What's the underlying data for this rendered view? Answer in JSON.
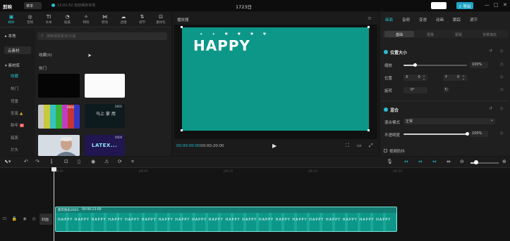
{
  "app": {
    "logo": "剪映",
    "menu_label": "菜单",
    "autosave_text": "13:01:52 自动保存本地",
    "project_title": "1723日",
    "export_label": "导出",
    "window_controls": [
      "—",
      "□",
      "✕"
    ]
  },
  "media_tabs": [
    {
      "icon": "▣",
      "label": "媒体",
      "icon_name": "media-icon",
      "active": true
    },
    {
      "icon": "◎",
      "label": "音频",
      "icon_name": "audio-icon"
    },
    {
      "icon": "TI",
      "label": "文本",
      "icon_name": "text-icon"
    },
    {
      "icon": "◔",
      "label": "贴纸",
      "icon_name": "sticker-icon"
    },
    {
      "icon": "✧",
      "label": "特效",
      "icon_name": "effects-icon"
    },
    {
      "icon": "⋈",
      "label": "转场",
      "icon_name": "transition-icon"
    },
    {
      "icon": "☁",
      "label": "滤镜",
      "icon_name": "filter-icon"
    },
    {
      "icon": "⇅",
      "label": "调节",
      "icon_name": "adjust-icon"
    },
    {
      "icon": "⊡",
      "label": "素材包",
      "icon_name": "package-icon"
    }
  ],
  "sidebar": {
    "local": "▸ 本地",
    "cloud": "云素材",
    "library": "▾ 素材库",
    "items": [
      "收藏",
      "热门",
      "背景",
      "圣诞",
      "新年",
      "搞笑",
      "片头"
    ],
    "christmas_badge": "▲",
    "new_year_badge": "新"
  },
  "search": {
    "placeholder": "搜索视频素材/元素"
  },
  "library": {
    "section_favorites": "收藏(0)",
    "section_hot": "热门",
    "thumb_bars_time": "0002",
    "thumb_dark_text": "马上 掌 用",
    "thumb_dark_time": "0001",
    "thumb_latex_text": "LATEX...",
    "thumb_latex_time": "0000"
  },
  "player": {
    "title": "播放器",
    "menu_icon": "≡",
    "canvas_text": "HAPPY",
    "canvas_hearts": "✦ ✦ ♥ ♥ ♥ ♥",
    "current_time": "00:00:00:00",
    "total_time": "00:00:20:00",
    "play_icon": "▶",
    "controls": [
      "⛶",
      "▭",
      "⤢"
    ]
  },
  "right_panel": {
    "tabs": [
      "画面",
      "音频",
      "变速",
      "动画",
      "跟踪",
      "调节"
    ],
    "subtabs": [
      "基础",
      "抠像",
      "蒙版",
      "背景填充"
    ],
    "position_size": {
      "title": "位置大小",
      "scale_label": "缩放",
      "scale_value": "100%",
      "scale_level": 0.18,
      "position_label": "位置",
      "x_label": "X",
      "x_value": "0",
      "y_label": "Y",
      "y_value": "0",
      "rotation_label": "旋转",
      "rotation_value": "0°"
    },
    "blend": {
      "title": "混合",
      "mode_label": "混合模式",
      "mode_value": "正常",
      "opacity_label": "不透明度",
      "opacity_value": "100%",
      "opacity_level": 1.0
    },
    "bottom_option": "视频防抖"
  },
  "timeline": {
    "ruler_labels": [
      "00:00",
      "|00:05",
      "|00:10",
      "|00:15",
      "|00:20"
    ],
    "cover_label": "封面",
    "track_icons": "⊡ 🔒 ◉ ◎",
    "clip_name": "新年快乐2025",
    "clip_duration": "00:00:23:00",
    "clip_frames_text": "HAPPY HAPPY HAPPY HAPPY HAPPY HAPPY HAPPY HAPPY HAPPY HAPPY HAPPY HAPPY HAPPY HAPPY HAPPY HAPPY HAPPY HAPPY HAPPY HAPPY"
  },
  "colors": {
    "accent": "#27bfd0",
    "canvas": "#0d9789",
    "panel": "#1f1f1f"
  }
}
